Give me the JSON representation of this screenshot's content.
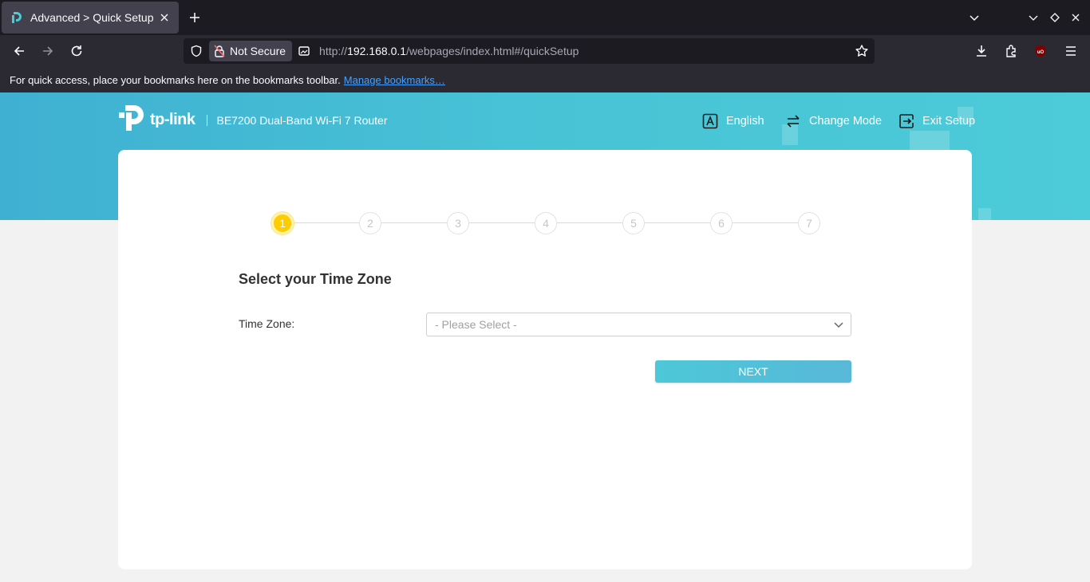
{
  "browser": {
    "tab_title": "Advanced > Quick Setup",
    "url_prefix": "http://",
    "url_host": "192.168.0.1",
    "url_path": "/webpages/index.html#/quickSetup",
    "security_label": "Not Secure",
    "bookmarks_message": "For quick access, place your bookmarks here on the bookmarks toolbar.",
    "bookmarks_link": "Manage bookmarks…"
  },
  "header": {
    "brand": "tp-link",
    "model": "BE7200 Dual-Band Wi-Fi 7 Router",
    "language_label": "English",
    "change_mode_label": "Change Mode",
    "exit_setup_label": "Exit Setup"
  },
  "stepper": {
    "steps": [
      "1",
      "2",
      "3",
      "4",
      "5",
      "6",
      "7"
    ],
    "active_step": 1
  },
  "form": {
    "title": "Select your Time Zone",
    "time_zone_label": "Time Zone:",
    "time_zone_placeholder": "- Please Select -",
    "next_label": "NEXT"
  },
  "colors": {
    "accent": "#4cc8d8",
    "active_step": "#ffcc00",
    "link": "#45a1ff"
  }
}
